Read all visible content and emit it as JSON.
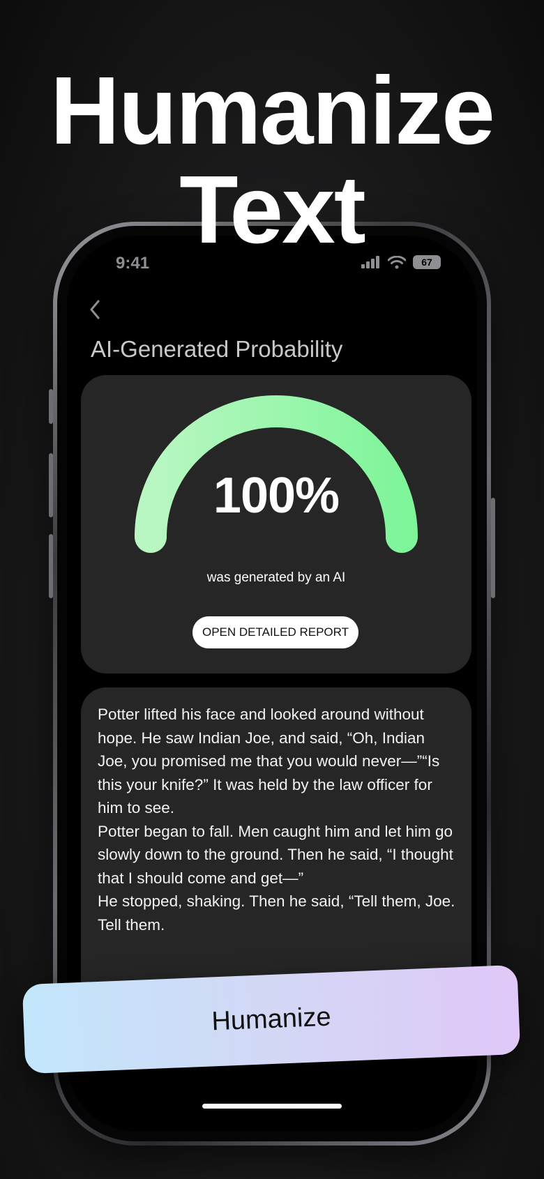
{
  "promo": {
    "headline_line1": "Humanize",
    "headline_line2": "Text"
  },
  "status_bar": {
    "time": "9:41",
    "battery": "67"
  },
  "header": {
    "title": "AI-Generated Probability"
  },
  "gauge": {
    "value": 100,
    "value_label": "100%",
    "caption": "was generated by an AI",
    "colors": {
      "start": "#b9f7c2",
      "end": "#7ff59a"
    }
  },
  "report": {
    "button_label": "OPEN DETAILED REPORT"
  },
  "text_card": {
    "paragraphs": [
      "Potter lifted his face and looked around without hope. He saw Indian Joe, and said, “Oh, Indian Joe, you promised me that you would never—”“Is this your knife?” It was held by the law officer for him to see.",
      "Potter began to fall. Men caught him and let him go slowly down to the ground. Then he said, “I thought that I should come and get—”",
      "He stopped, shaking. Then he said, “Tell them, Joe. Tell them."
    ]
  },
  "cta": {
    "label": "Humanize"
  }
}
